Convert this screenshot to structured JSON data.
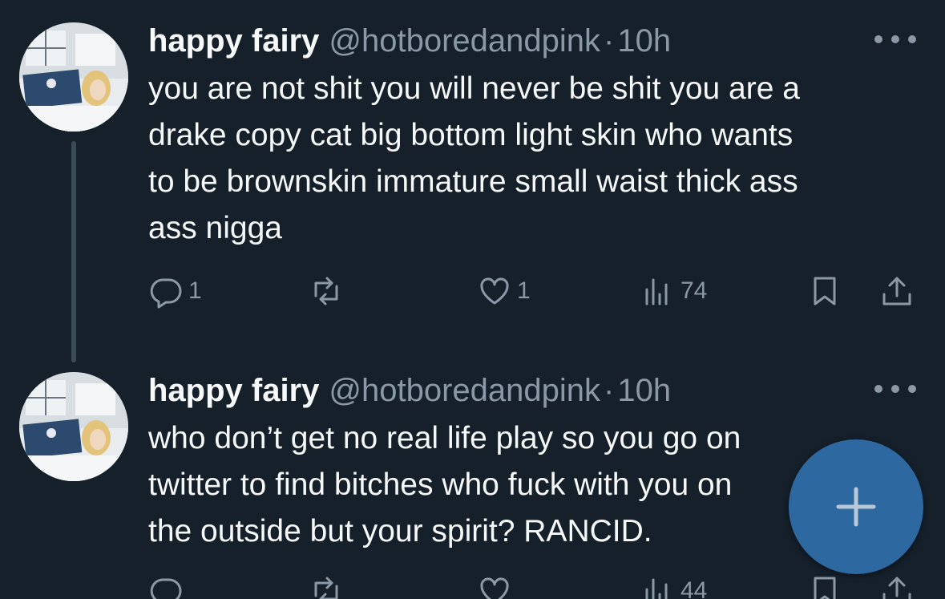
{
  "tweets": [
    {
      "author_name": "happy fairy",
      "handle": "@hotboredandpink",
      "separator": "·",
      "time": "10h",
      "text": "you are not shit you will never be shit you are a\ndrake copy cat big bottom light skin who wants\nto be brownskin immature small waist thick ass\nass nigga",
      "reply_count": "1",
      "retweet_count": "",
      "like_count": "1",
      "view_count": "74"
    },
    {
      "author_name": "happy fairy",
      "handle": "@hotboredandpink",
      "separator": "·",
      "time": "10h",
      "text": "who don’t get no real life play so you go on\ntwitter to find bitches who fuck with you on\nthe outside but your spirit? RANCID.",
      "reply_count": "",
      "retweet_count": "",
      "like_count": "",
      "view_count": "44"
    }
  ],
  "icons": {
    "reply": "reply-icon",
    "retweet": "retweet-icon",
    "like": "heart-icon",
    "views": "views-icon",
    "bookmark": "bookmark-icon",
    "share": "share-icon",
    "more": "more-icon",
    "compose": "plus-icon"
  },
  "colors": {
    "background": "#15202b",
    "text_primary": "#f7f9f9",
    "text_secondary": "#8b98a5",
    "thread_line": "#3d4b59",
    "fab": "#316faa"
  }
}
